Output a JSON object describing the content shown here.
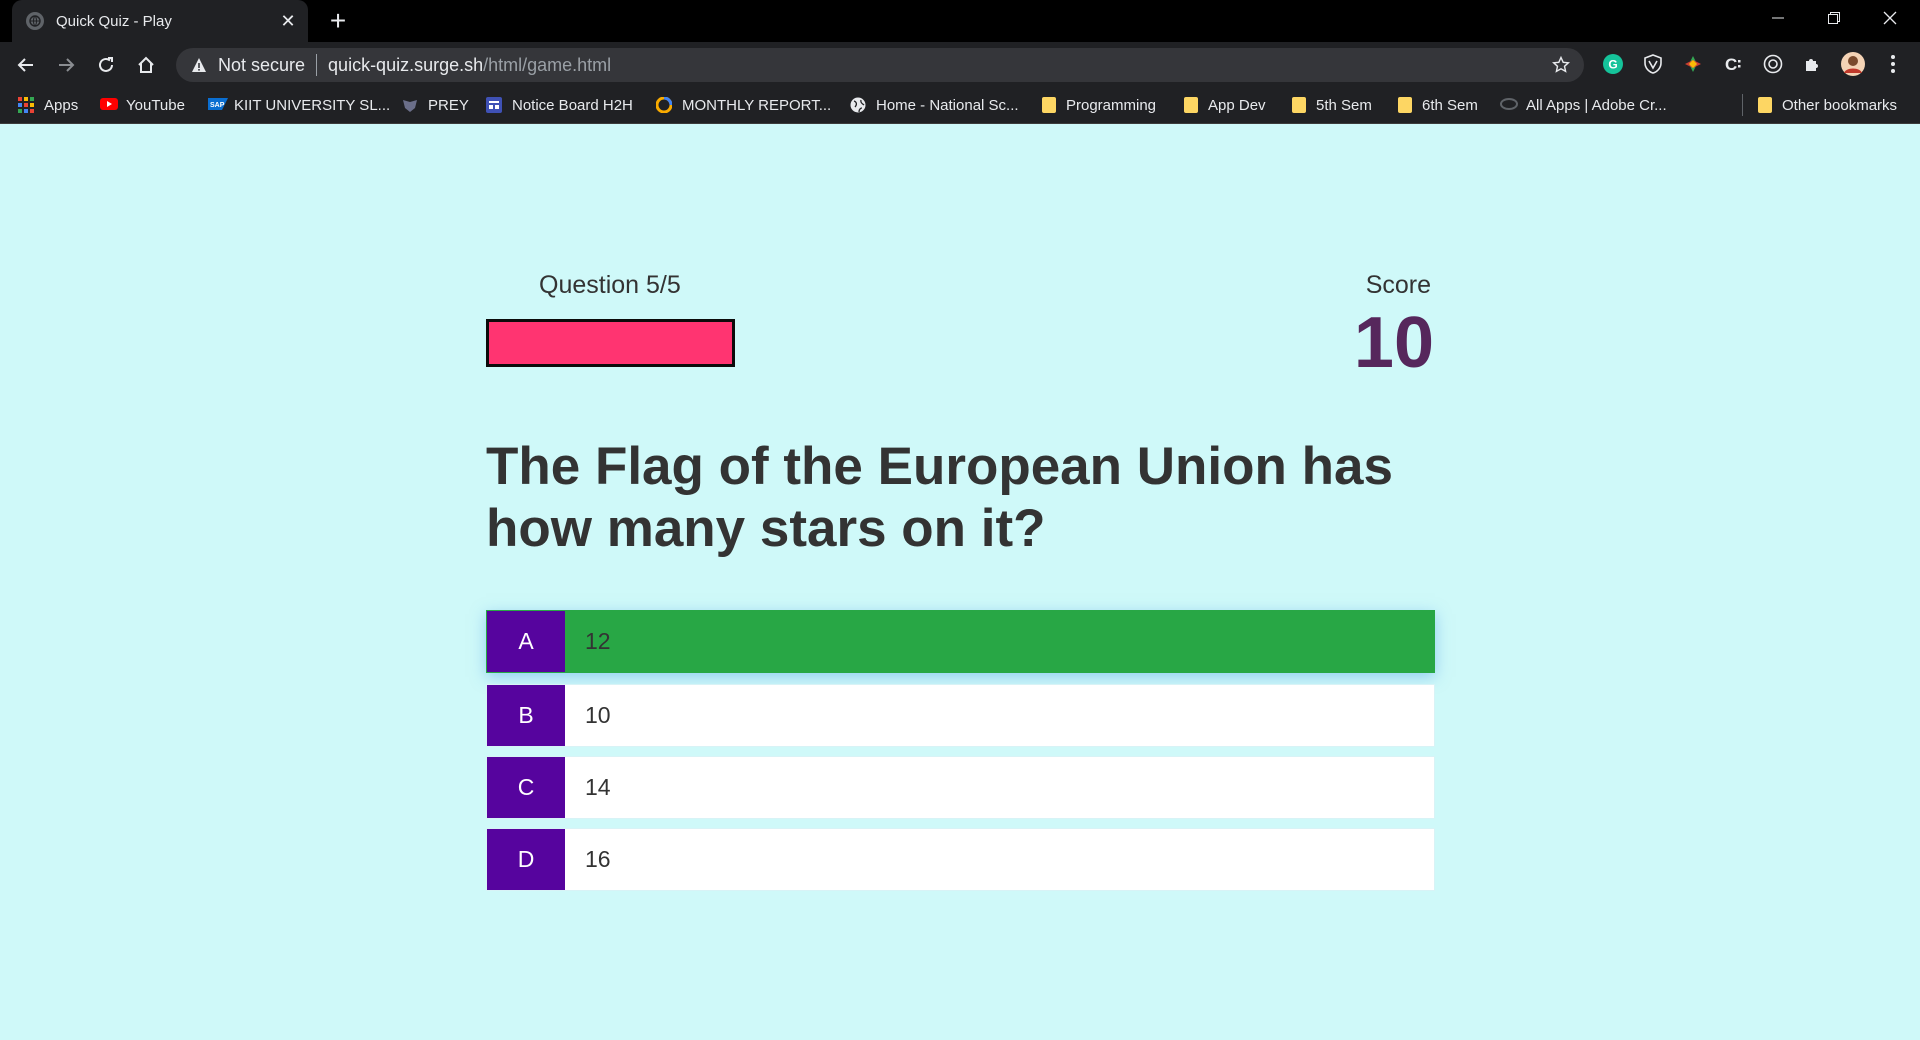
{
  "browser": {
    "tab_title": "Quick Quiz - Play",
    "security_label": "Not secure",
    "url_host": "quick-quiz.surge.sh",
    "url_path": "/html/game.html"
  },
  "bookmarks": [
    {
      "label": "Apps",
      "icon": "apps-grid-icon"
    },
    {
      "label": "YouTube",
      "icon": "youtube-icon"
    },
    {
      "label": "KIIT UNIVERSITY SL...",
      "icon": "sap-icon"
    },
    {
      "label": "PREY",
      "icon": "prey-icon"
    },
    {
      "label": "Notice Board H2H",
      "icon": "notice-board-icon"
    },
    {
      "label": "MONTHLY REPORT...",
      "icon": "report-icon"
    },
    {
      "label": "Home - National Sc...",
      "icon": "globe-icon"
    },
    {
      "label": "Programming",
      "icon": "folder-icon"
    },
    {
      "label": "App Dev",
      "icon": "folder-icon"
    },
    {
      "label": "5th Sem",
      "icon": "folder-icon"
    },
    {
      "label": "6th Sem",
      "icon": "folder-icon"
    },
    {
      "label": "All Apps | Adobe Cr...",
      "icon": "adobe-icon"
    },
    {
      "label": "Other bookmarks",
      "icon": "folder-icon"
    }
  ],
  "hud": {
    "question_counter": "Question 5/5",
    "progress_fraction": 1.0,
    "score_label": "Score",
    "score_value": "10"
  },
  "question": {
    "text": "The Flag of the European Union has how many stars on it?"
  },
  "choices": [
    {
      "prefix": "A",
      "text": "12",
      "state": "correct"
    },
    {
      "prefix": "B",
      "text": "10",
      "state": "default"
    },
    {
      "prefix": "C",
      "text": "14",
      "state": "default"
    },
    {
      "prefix": "D",
      "text": "16",
      "state": "default"
    }
  ],
  "colors": {
    "page_background": "#cff9f9",
    "progress_fill": "#ff3471",
    "score_color": "#56275c",
    "choice_prefix": "#56049e",
    "correct_choice": "#28a745"
  }
}
